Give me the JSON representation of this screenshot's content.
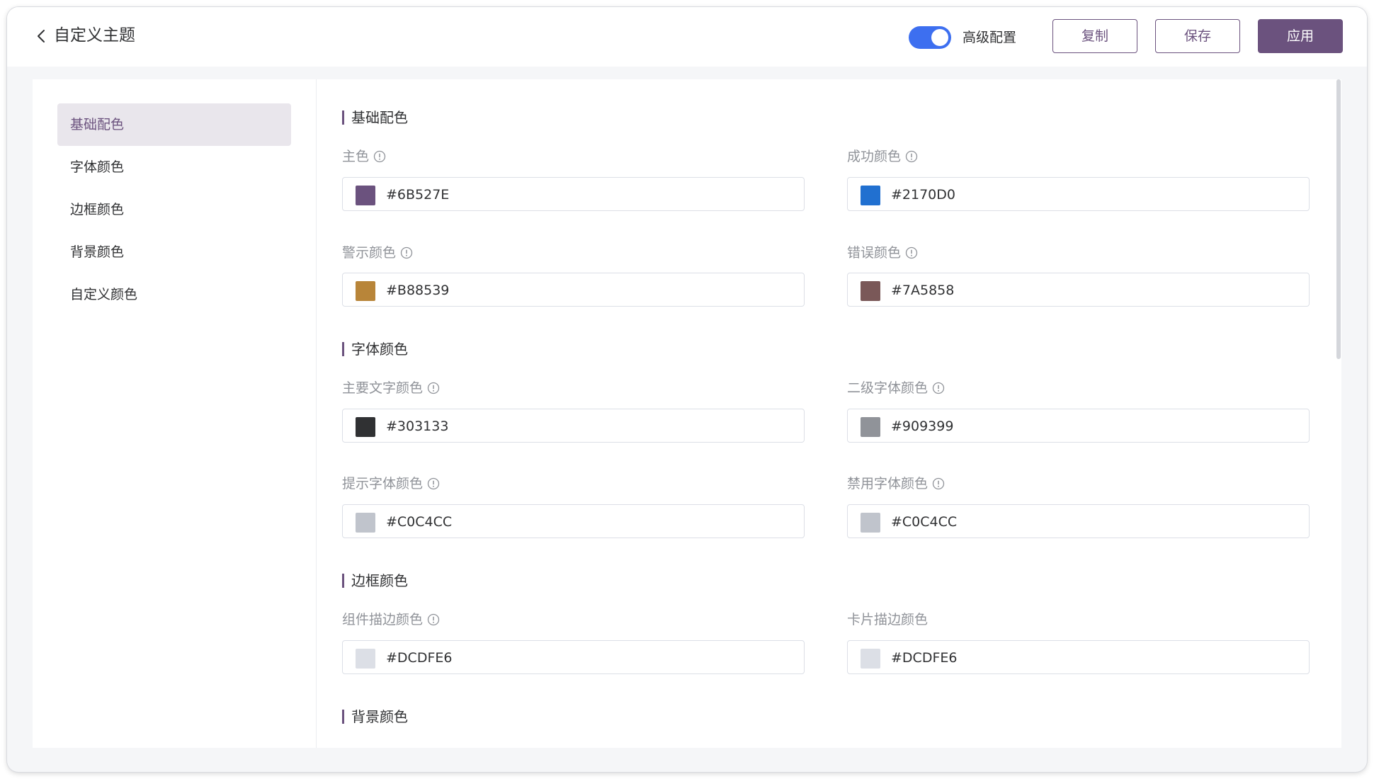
{
  "header": {
    "title": "自定义主题",
    "toggle_label": "高级配置",
    "toggle_on": true,
    "copy_label": "复制",
    "save_label": "保存",
    "apply_label": "应用"
  },
  "colors": {
    "accent": "#6B527E",
    "toggle": "#3D6FF0"
  },
  "sidebar": {
    "items": [
      {
        "label": "基础配色",
        "active": true
      },
      {
        "label": "字体颜色",
        "active": false
      },
      {
        "label": "边框颜色",
        "active": false
      },
      {
        "label": "背景颜色",
        "active": false
      },
      {
        "label": "自定义颜色",
        "active": false
      }
    ]
  },
  "sections": [
    {
      "title": "基础配色",
      "fields": [
        {
          "label": "主色",
          "value": "#6B527E",
          "info": true
        },
        {
          "label": "成功颜色",
          "value": "#2170D0",
          "info": true
        },
        {
          "label": "警示颜色",
          "value": "#B88539",
          "info": true
        },
        {
          "label": "错误颜色",
          "value": "#7A5858",
          "info": true
        }
      ]
    },
    {
      "title": "字体颜色",
      "fields": [
        {
          "label": "主要文字颜色",
          "value": "#303133",
          "info": true
        },
        {
          "label": "二级字体颜色",
          "value": "#909399",
          "info": true
        },
        {
          "label": "提示字体颜色",
          "value": "#C0C4CC",
          "info": true
        },
        {
          "label": "禁用字体颜色",
          "value": "#C0C4CC",
          "info": true
        }
      ]
    },
    {
      "title": "边框颜色",
      "fields": [
        {
          "label": "组件描边颜色",
          "value": "#DCDFE6",
          "info": true
        },
        {
          "label": "卡片描边颜色",
          "value": "#DCDFE6",
          "info": false
        }
      ]
    },
    {
      "title": "背景颜色",
      "fields": []
    }
  ]
}
